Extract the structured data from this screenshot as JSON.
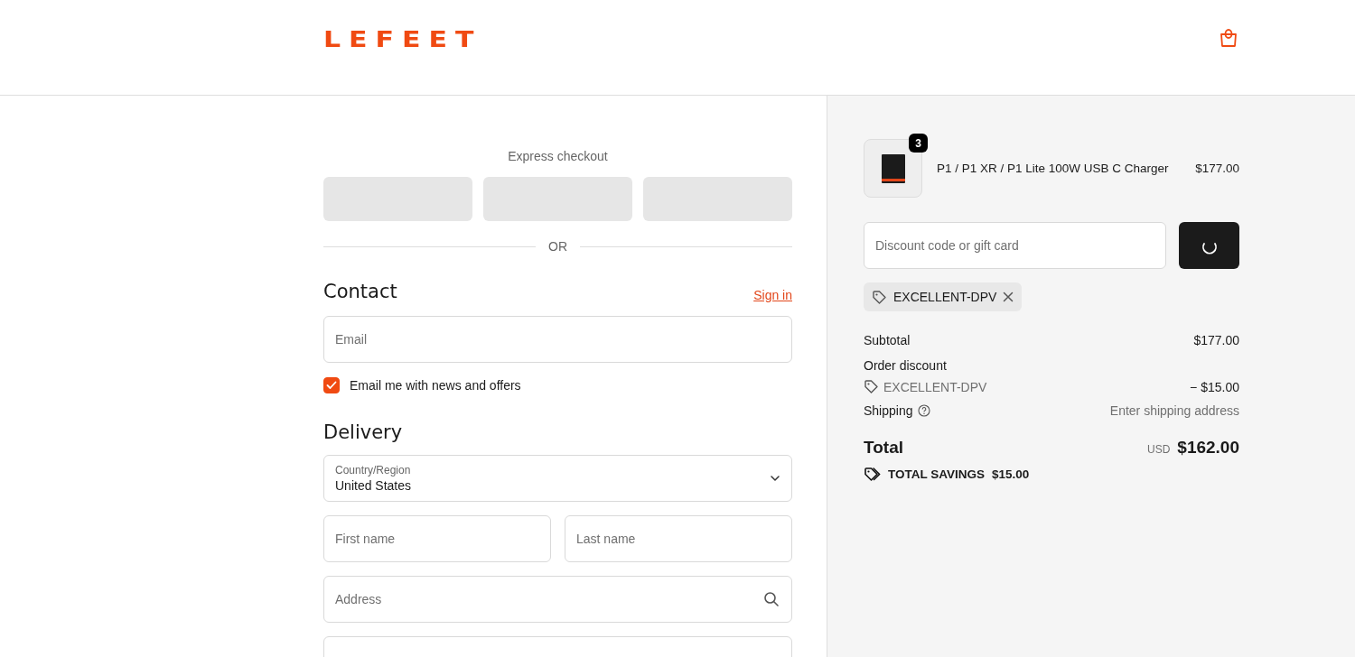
{
  "header": {
    "logo": "LEFEET"
  },
  "express_checkout": {
    "title": "Express checkout",
    "buttons": [
      {
        "kind": "loading"
      },
      {
        "kind": "loading"
      },
      {
        "kind": "loading"
      }
    ]
  },
  "divider_label": "OR",
  "contact": {
    "title": "Contact",
    "sign_in": "Sign in",
    "email": {
      "placeholder": "Email"
    },
    "newsletter": {
      "label": "Email me with news and offers",
      "checked": true
    }
  },
  "delivery": {
    "title": "Delivery",
    "country": {
      "label": "Country/Region",
      "value": "United States"
    },
    "first_name": {
      "placeholder": "First name"
    },
    "last_name": {
      "placeholder": "Last name"
    },
    "address": {
      "placeholder": "Address"
    },
    "more_fields": [
      {
        "kind": "text"
      }
    ]
  },
  "summary": {
    "items": [
      {
        "name": "P1 / P1 XR / P1 Lite 100W USB C Charger",
        "price": "$177.00",
        "quantity": "3"
      }
    ],
    "discount_field": {
      "placeholder": "Discount code or gift card"
    },
    "apply_button": {
      "loading": true
    },
    "applied_codes": [
      "EXCELLENT-DPV"
    ],
    "subtotal": {
      "label": "Subtotal",
      "value": "$177.00"
    },
    "order_discount": {
      "label": "Order discount",
      "code": "EXCELLENT-DPV",
      "amount": "− $15.00"
    },
    "shipping": {
      "label": "Shipping",
      "value": "Enter shipping address"
    },
    "total": {
      "label": "Total",
      "currency": "USD",
      "amount": "$162.00"
    },
    "savings": {
      "label": "TOTAL SAVINGS",
      "amount": "$15.00"
    }
  }
}
